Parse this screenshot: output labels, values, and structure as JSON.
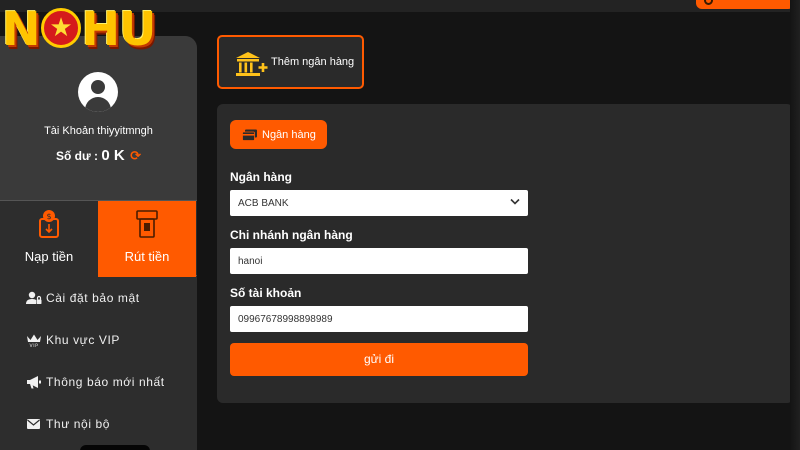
{
  "brand": {
    "logo_left": "N",
    "logo_right": "HU"
  },
  "user": {
    "account_label": "Tài Khoản",
    "username": "thiyyitmngh",
    "balance_label": "Số dư :",
    "balance_value": "0 K"
  },
  "tabs": [
    {
      "label": "Nạp tiền",
      "icon": "deposit-icon",
      "active": false
    },
    {
      "label": "Rút tiền",
      "icon": "withdraw-icon",
      "active": true
    }
  ],
  "menu": [
    {
      "label": "Cài đặt bảo mật",
      "icon": "user-lock-icon"
    },
    {
      "label": "Khu vực VIP",
      "icon": "vip-crown-icon"
    },
    {
      "label": "Thông báo mới nhất",
      "icon": "megaphone-icon"
    },
    {
      "label": "Thư nội bộ",
      "icon": "envelope-icon"
    }
  ],
  "add_bank": {
    "label": "Thêm ngân hàng",
    "icon": "bank-add-icon"
  },
  "form": {
    "chip_label": "Ngân hàng",
    "bank": {
      "label": "Ngân hàng",
      "value": "ACB BANK"
    },
    "branch": {
      "label": "Chi nhánh ngân hàng",
      "value": "hanoi"
    },
    "account_number": {
      "label": "Số tài khoản",
      "value": "09967678998898989"
    },
    "submit_label": "gửi đi"
  },
  "colors": {
    "accent": "#ff5a00",
    "panel": "#2a2a2a",
    "background": "#141414"
  }
}
